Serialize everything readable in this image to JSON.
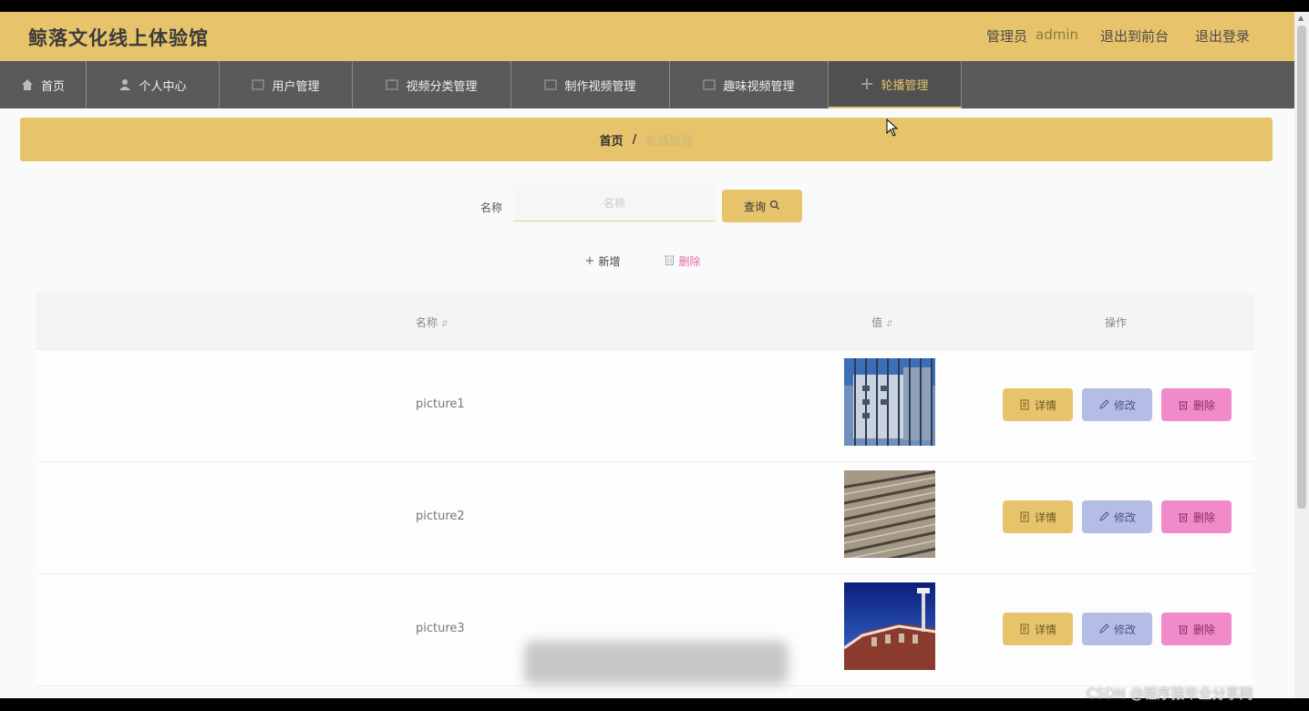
{
  "header": {
    "title": "鲸落文化线上体验馆",
    "role_label": "管理员",
    "username": "admin",
    "front_link": "退出到前台",
    "logout_link": "退出登录",
    "bg_color": "#e7c46b"
  },
  "nav": {
    "items": [
      {
        "label": "首页",
        "icon": "home-icon"
      },
      {
        "label": "个人中心",
        "icon": "user-icon"
      },
      {
        "label": "用户管理",
        "icon": "grid-icon"
      },
      {
        "label": "视频分类管理",
        "icon": "grid-icon"
      },
      {
        "label": "制作视频管理",
        "icon": "grid-icon"
      },
      {
        "label": "趣味视频管理",
        "icon": "grid-icon"
      },
      {
        "label": "轮播管理",
        "icon": "plus-icon"
      }
    ],
    "active_index": 6
  },
  "breadcrumb": {
    "home": "首页",
    "separator": "/",
    "current": "轮播管理"
  },
  "search": {
    "label": "名称",
    "placeholder": "名称",
    "button_label": "查询"
  },
  "actions": {
    "add_label": "新增",
    "delete_label": "删除"
  },
  "table": {
    "columns": [
      "名称",
      "值",
      "操作"
    ],
    "rows": [
      {
        "name": "picture1",
        "image": "building-photo"
      },
      {
        "name": "picture2",
        "image": "rail-tracks-photo"
      },
      {
        "name": "picture3",
        "image": "stadium-photo"
      }
    ],
    "row_buttons": {
      "detail": "详情",
      "edit": "修改",
      "delete": "删除"
    }
  },
  "watermark": "CSDN @程序猿毕业分享网"
}
